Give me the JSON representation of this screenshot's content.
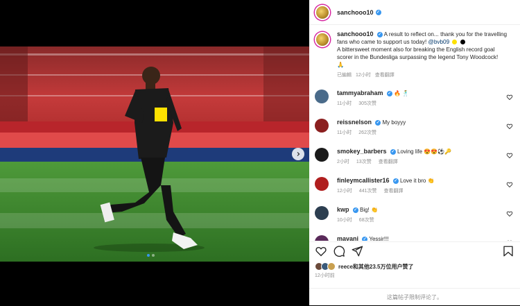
{
  "post": {
    "username": "sanchooo10",
    "caption_line1": "A result to reflect on... thank you for the travelling fans who came to support us today!",
    "caption_tag": "@bvb09",
    "caption_line2": "A bittersweet moment also for breaking the English record goal scorer in the Bundesliga surpassing the legend Tony Woodcock!",
    "edited_label": "已編輯",
    "time": "12小时",
    "translate": "查看翻譯",
    "caption_emoji_end": "🙏",
    "jersey_number": "18",
    "accent_colors": {
      "bvb_yellow": "#fde100",
      "verified_blue": "#3897f0",
      "like_red": "#ed4956"
    }
  },
  "comments": [
    {
      "username": "tammyabraham",
      "text": "🔥 🕺",
      "time": "11小时",
      "likes": "305次赞",
      "reply": "",
      "avatar_color": "#4a6b8a"
    },
    {
      "username": "reissnelson",
      "text": "My boyyy",
      "time": "11小时",
      "likes": "262次赞",
      "reply": "",
      "avatar_color": "#8b1f1f"
    },
    {
      "username": "smokey_barbers",
      "text": "Loving life 😍😍⚽🔑",
      "time": "2小时",
      "likes": "13次赞",
      "reply": "查看翻譯",
      "avatar_color": "#1a1a1a"
    },
    {
      "username": "finleymcallister16",
      "text": "Love it bro 👏",
      "time": "12小时",
      "likes": "441次赞",
      "reply": "查看翻譯",
      "avatar_color": "#b01e1e"
    },
    {
      "username": "kwp",
      "text": "Big! 👏",
      "time": "10小时",
      "likes": "68次赞",
      "reply": "",
      "avatar_color": "#2c3e50"
    },
    {
      "username": "mavani",
      "text": "Yessir!!!",
      "time": "",
      "likes": "",
      "reply": "",
      "avatar_color": "#5a2a5a"
    }
  ],
  "likes_summary": {
    "text": "reece和其他23.5万位用户赞了"
  },
  "post_time": "12小时前",
  "footer_text": "这篇帖子限制评论了。",
  "icons": [
    "heart-icon",
    "comment-icon",
    "share-icon",
    "bookmark-icon",
    "chevron-right-icon",
    "verified-icon"
  ]
}
